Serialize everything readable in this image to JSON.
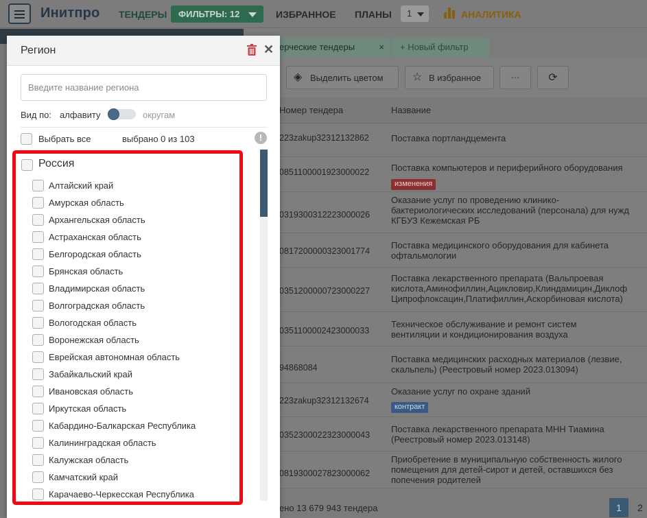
{
  "navbar": {
    "logo": "Инитпро",
    "tenders": "ТЕНДЕРЫ",
    "filters": "ФИЛЬТРЫ: 12",
    "favorites": "ИЗБРАННОЕ",
    "plans": "ПЛАНЫ",
    "plan_number": "1",
    "analytics": "АНАЛИТИКА"
  },
  "tabs": {
    "active": "ерческие тендеры",
    "new_filter": "Новый фильтр"
  },
  "toolbar": {
    "highlight_color": "Выделить цветом",
    "to_favorites": "В избранное",
    "more": "···"
  },
  "table": {
    "col_number": "Номер тендера",
    "col_name": "Название",
    "rows": [
      {
        "num": "223zakup32312132862",
        "name": [
          "Поставка портландцемента"
        ]
      },
      {
        "num": "0851100001923000022",
        "name": [
          "Поставка компьютеров и периферийного оборудования"
        ],
        "badge": "изменения"
      },
      {
        "num": "0319300312223000026",
        "name": [
          "Оказание услуг по проведению клинико-",
          "бактериологических исследований (персонала) для нужд",
          "КГБУЗ Кежемская РБ"
        ]
      },
      {
        "num": "0817200000323001774",
        "name": [
          "Поставка медицинского оборудования для кабинета",
          "офтальмологии"
        ]
      },
      {
        "num": "0351200000723000227",
        "name": [
          "Поставка лекарственного препарата (Вальпроевая",
          "кислота,Аминофиллин,Ацикловир,Клиндамицин,Диклоф",
          "Ципрофлоксацин,Платифиллин,Аскорбиновая кислота)"
        ]
      },
      {
        "num": "0351100002423000033",
        "name": [
          "Техническое обслуживание и ремонт систем",
          "вентиляции и кондиционирования воздуха"
        ]
      },
      {
        "num": "94868084",
        "name": [
          "Поставка медицинских расходных материалов (лезвие,",
          "скальпель) (Реестровый номер 2023.013094)"
        ]
      },
      {
        "num": "223zakup32312132674",
        "name": [
          "Оказание услуг по охране зданий"
        ],
        "badge": "контракт"
      },
      {
        "num": "0352300022323000043",
        "name": [
          "Поставка лекарственного препарата МНН Тиамина",
          "(Реестровый номер 2023.013148)"
        ]
      },
      {
        "num": "0819300027823000062",
        "name": [
          "Приобретение в муниципальную собственность жилого",
          "помещения для детей-сирот и детей, оставшихся без",
          "попечения родителей"
        ]
      }
    ],
    "total": "ено 13 679 943 тендера",
    "page_current": "1",
    "page_next": "2"
  },
  "modal": {
    "title": "Регион",
    "search_placeholder": "Введите название региона",
    "view_by": "Вид по:",
    "view_alpha": "алфавиту",
    "view_okrug": "округам",
    "select_all": "Выбрать все",
    "selected_count": "выбрано 0 из 103",
    "country": "Россия",
    "regions": [
      "Алтайский край",
      "Амурская область",
      "Архангельская область",
      "Астраханская область",
      "Белгородская область",
      "Брянская область",
      "Владимирская область",
      "Волгоградская область",
      "Вологодская область",
      "Воронежская область",
      "Еврейская автономная область",
      "Забайкальский край",
      "Ивановская область",
      "Иркутская область",
      "Кабардино-Балкарская Республика",
      "Калининградская область",
      "Калужская область",
      "Камчатский край",
      "Карачаево-Черкесская Республика"
    ]
  },
  "colors": {
    "highlight": "#f00812",
    "brand_green": "#2e6a50",
    "accent_blue": "#3e5a72"
  }
}
